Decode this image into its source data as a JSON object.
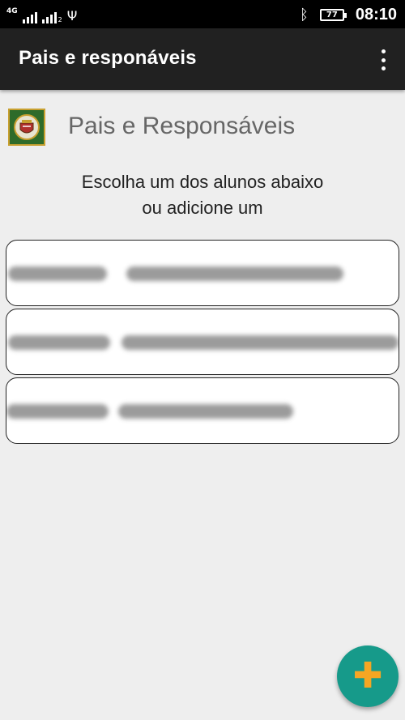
{
  "status_bar": {
    "network": "4G",
    "sim2": "2",
    "battery": "77",
    "time": "08:10"
  },
  "app_bar": {
    "title": "Pais e responáveis"
  },
  "page": {
    "title": "Pais e Responsáveis",
    "instruction_line1": "Escolha um dos alunos abaixo",
    "instruction_line2": "ou adicione um"
  },
  "students": [
    {
      "name": "",
      "redacted": true
    },
    {
      "name": "",
      "redacted": true
    },
    {
      "name": "",
      "redacted": true
    }
  ],
  "icons": {
    "menu": "more-vert-icon",
    "add": "plus-icon",
    "bluetooth": "bluetooth-icon",
    "usb": "usb-icon",
    "logo": "school-crest-logo"
  },
  "colors": {
    "app_bar": "#212121",
    "background": "#eeeeee",
    "fab": "#169a8a",
    "fab_icon": "#f5a623",
    "logo_bg": "#2e6b2a"
  }
}
